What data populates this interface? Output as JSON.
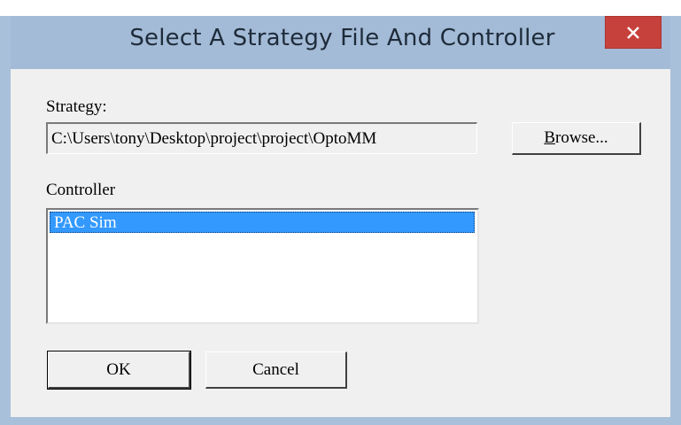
{
  "window": {
    "title": "Select A Strategy File And Controller",
    "close_label": "✕"
  },
  "strategy": {
    "label": "Strategy:",
    "value": "C:\\Users\\tony\\Desktop\\project\\project\\OptoMM",
    "browse_label_prefix": "B",
    "browse_label_rest": "rowse..."
  },
  "controller": {
    "label": "Controller",
    "items": [
      "PAC Sim"
    ],
    "selected": "PAC Sim"
  },
  "buttons": {
    "ok_label": "OK",
    "cancel_label": "Cancel"
  },
  "colors": {
    "title_bar": "#a3bbd6",
    "close_button": "#c7413c",
    "selection": "#3399ff",
    "dialog_face": "#f0f0f0"
  }
}
